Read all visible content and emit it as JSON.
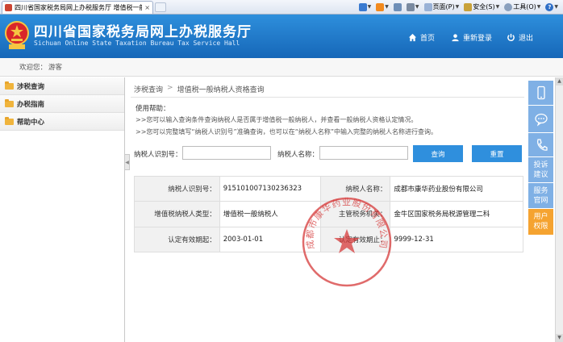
{
  "browser": {
    "tab_title": "四川省国家税务局网上办税服务厅 增值税一般纳...",
    "tab_close": "×",
    "toolbar": {
      "page_label": "页面(P)",
      "safety_label": "安全(S)",
      "tools_label": "工具(O)",
      "help_glyph": "?",
      "dropdown_glyph": "▼"
    }
  },
  "header": {
    "title": "四川省国家税务局网上办税服务厅",
    "subtitle": "Sichuan Online State Taxation Bureau Tax Service Hall",
    "nav": [
      {
        "label": "首页",
        "icon": "home-icon"
      },
      {
        "label": "重新登录",
        "icon": "user-icon"
      },
      {
        "label": "退出",
        "icon": "power-icon"
      }
    ]
  },
  "welcome": {
    "prefix": "欢迎您：",
    "user": "游客"
  },
  "sidebar": {
    "items": [
      {
        "label": "涉税查询",
        "icon": "folder-icon"
      },
      {
        "label": "办税指南",
        "icon": "folder-icon"
      },
      {
        "label": "帮助中心",
        "icon": "folder-icon"
      }
    ],
    "collapse_glyph": "◀"
  },
  "main": {
    "breadcrumb": {
      "parent": "涉税查询",
      "sep": ">",
      "current": "增值税一般纳税人资格查询"
    },
    "help": {
      "title": "使用帮助：",
      "lines": [
        ">>您可以输入查询条件查询纳税人是否属于增值税一般纳税人，并查看一般纳税人资格认定情况。",
        ">>您可以完整填写“纳税人识别号”准确查询，也可以在“纳税人名称”中输入完整的纳税人名称进行查询。"
      ]
    },
    "query": {
      "id_label": "纳税人识别号：",
      "id_value": "",
      "name_label": "纳税人名称：",
      "name_value": "",
      "search_button": "查询",
      "reset_button": "重置"
    },
    "result": {
      "rows": [
        [
          {
            "label": "纳税人识别号：",
            "value": "915101007130236323"
          },
          {
            "label": "纳税人名称：",
            "value": "成都市康华药业股份有限公司"
          }
        ],
        [
          {
            "label": "增值税纳税人类型：",
            "value": "增值税一般纳税人"
          },
          {
            "label": "主管税务机关：",
            "value": "金牛区国家税务局税源管理二科"
          }
        ],
        [
          {
            "label": "认定有效期起：",
            "value": "2003-01-01"
          },
          {
            "label": "认定有效期止：",
            "value": "9999-12-31"
          }
        ]
      ]
    }
  },
  "stamp": {
    "text": "成都市康华药业股份有限公司",
    "color": "#d63a3a"
  },
  "right_toolbar": {
    "items": [
      {
        "icon": "phone-icon",
        "label": ""
      },
      {
        "icon": "chat-icon",
        "label": ""
      },
      {
        "icon": "call-icon",
        "label": ""
      },
      {
        "icon": "",
        "label": "投诉建议"
      },
      {
        "icon": "",
        "label": "服务官网"
      },
      {
        "icon": "",
        "label": "用户权限"
      }
    ]
  },
  "colors": {
    "header_blue": "#1f7ccb",
    "button_blue": "#2f8fdd",
    "toolbar_blue": "#7fb0e5",
    "toolbar_orange": "#f5a330"
  }
}
